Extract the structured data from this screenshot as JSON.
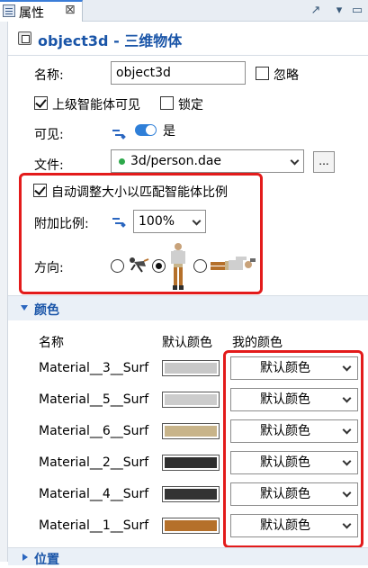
{
  "tab": {
    "label": "属性",
    "close": "⊠"
  },
  "header": {
    "title": "object3d - 三维物体"
  },
  "form": {
    "name_label": "名称:",
    "name_value": "object3d",
    "ignore_label": "忽略",
    "parent_visible_label": "上级智能体可见",
    "lock_label": "锁定",
    "visible_label": "可见:",
    "visible_value": "是",
    "file_label": "文件:",
    "file_value": "3d/person.dae",
    "file_browse": "...",
    "autoscale_label": "自动调整大小以匹配智能体比例",
    "scale_label": "附加比例:",
    "scale_value": "100%",
    "direction_label": "方向:"
  },
  "color_section": {
    "title": "颜色",
    "col_name": "名称",
    "col_default": "默认颜色",
    "col_mine": "我的颜色",
    "materials": [
      {
        "name": "Material__3__Surf",
        "color": "#c8c8c8",
        "my_color": "默认颜色"
      },
      {
        "name": "Material__5__Surf",
        "color": "#cccccc",
        "my_color": "默认颜色"
      },
      {
        "name": "Material__6__Surf",
        "color": "#c8b48a",
        "my_color": "默认颜色"
      },
      {
        "name": "Material__2__Surf",
        "color": "#2e2e2e",
        "my_color": "默认颜色"
      },
      {
        "name": "Material__4__Surf",
        "color": "#333333",
        "my_color": "默认颜色"
      },
      {
        "name": "Material__1__Surf",
        "color": "#b5702a",
        "my_color": "默认颜色"
      }
    ]
  },
  "position_section": {
    "title": "位置"
  },
  "accent": "#e31b1b"
}
